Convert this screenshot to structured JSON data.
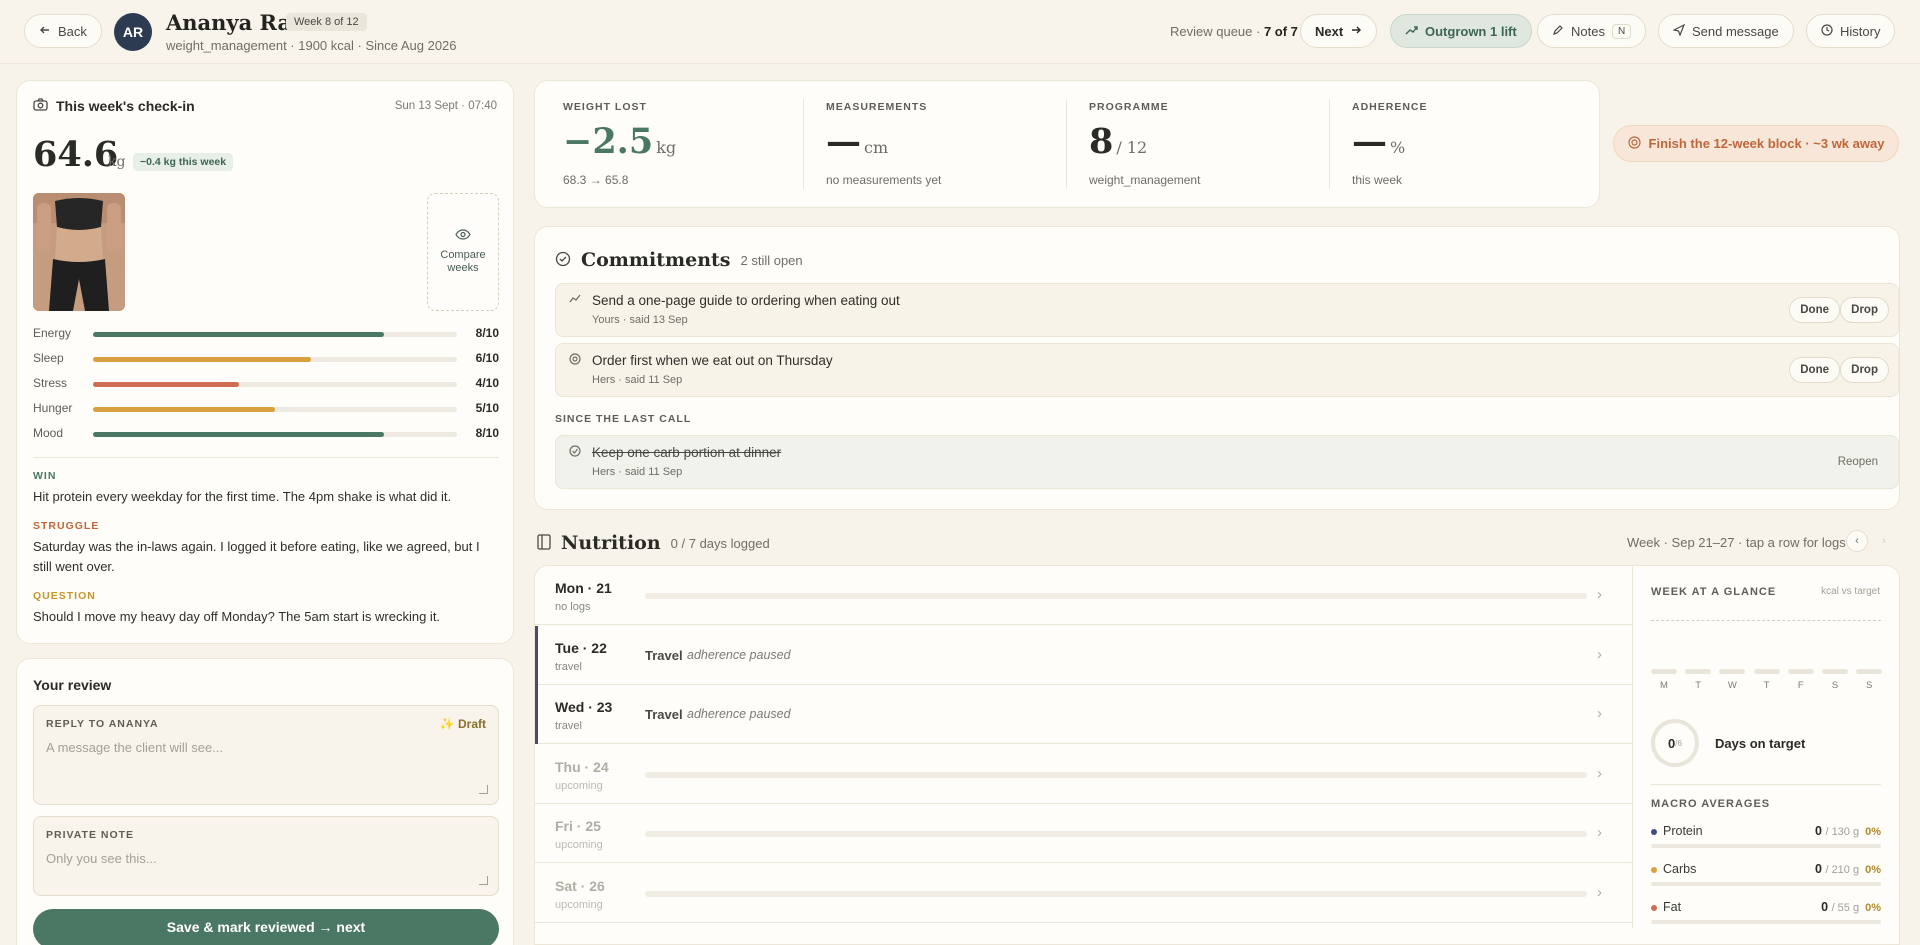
{
  "header": {
    "back_label": "Back",
    "avatar_initials": "AR",
    "client_name": "Ananya Rao",
    "week_badge": "Week 8 of 12",
    "client_sub": "weight_management · 1900 kcal · Since Aug 2026",
    "queue_label": "Review queue ·",
    "queue_pos": "7 of 7",
    "next_label": "Next",
    "outgrown_label": "Outgrown 1 lift",
    "notes_label": "Notes",
    "notes_shortcut": "N",
    "send_label": "Send message",
    "history_label": "History"
  },
  "checkin": {
    "title": "This week's check-in",
    "timestamp": "Sun 13 Sept · 07:40",
    "weight": "64.6",
    "unit": "kg",
    "delta": "−0.4 kg this week",
    "compare_label": "Compare weeks",
    "metrics": [
      {
        "label": "Energy",
        "value": "8/10",
        "score": 8,
        "color": "#4b7765"
      },
      {
        "label": "Sleep",
        "value": "6/10",
        "score": 6,
        "color": "#d8a03e"
      },
      {
        "label": "Stress",
        "value": "4/10",
        "score": 4,
        "color": "#cf6d52"
      },
      {
        "label": "Hunger",
        "value": "5/10",
        "score": 5,
        "color": "#d8a03e"
      },
      {
        "label": "Mood",
        "value": "8/10",
        "score": 8,
        "color": "#4b7765"
      }
    ],
    "win_label": "WIN",
    "win_text": "Hit protein every weekday for the first time. The 4pm shake is what did it.",
    "struggle_label": "STRUGGLE",
    "struggle_text": "Saturday was the in-laws again. I logged it before eating, like we agreed, but I still went over.",
    "question_label": "QUESTION",
    "question_text": "Should I move my heavy day off Monday? The 5am start is wrecking it."
  },
  "review": {
    "title": "Your review",
    "reply_label": "REPLY TO ANANYA",
    "draft_label": "Draft",
    "reply_placeholder": "A message the client will see...",
    "note_label": "PRIVATE NOTE",
    "note_placeholder": "Only you see this...",
    "save_label": "Save & mark reviewed → next"
  },
  "stats": [
    {
      "label": "WEIGHT LOST",
      "value": "−2.5",
      "unit": "kg",
      "sub": "68.3 → 65.8"
    },
    {
      "label": "MEASUREMENTS",
      "value": "—",
      "unit": "cm",
      "sub": "no measurements yet"
    },
    {
      "label": "PROGRAMME",
      "value": "8",
      "unit": "/ 12",
      "sub": "weight_management"
    },
    {
      "label": "ADHERENCE",
      "value": "—",
      "unit": "%",
      "sub": "this week"
    }
  ],
  "goal_pill": "Finish the 12-week block · ~3 wk away",
  "commitments": {
    "title": "Commitments",
    "count": "2 still open",
    "open": [
      {
        "text": "Send a one-page guide to ordering when eating out",
        "sub": "Yours · said 13 Sep"
      },
      {
        "text": "Order first when we eat out on Thursday",
        "sub": "Hers · said 11 Sep"
      }
    ],
    "done_label": "Done",
    "drop_label": "Drop",
    "since_label": "SINCE THE LAST CALL",
    "closed": {
      "text": "Keep one carb portion at dinner",
      "sub": "Hers · said 11 Sep"
    },
    "reopen_label": "Reopen"
  },
  "nutrition": {
    "title": "Nutrition",
    "logged": "0 / 7 days logged",
    "week_label": "Week · Sep 21–27 · tap a row for logs",
    "days": [
      {
        "name": "Mon · 21",
        "sub": "no logs",
        "state": "empty"
      },
      {
        "name": "Tue · 22",
        "sub": "travel",
        "state": "travel"
      },
      {
        "name": "Wed · 23",
        "sub": "travel",
        "state": "travel"
      },
      {
        "name": "Thu · 24",
        "sub": "upcoming",
        "state": "upcoming"
      },
      {
        "name": "Fri · 25",
        "sub": "upcoming",
        "state": "upcoming"
      },
      {
        "name": "Sat · 26",
        "sub": "upcoming",
        "state": "upcoming"
      }
    ],
    "travel_label": "Travel",
    "paused_label": "adherence paused",
    "glance_title": "WEEK AT A GLANCE",
    "glance_key": "kcal vs target",
    "weekday_letters": [
      "M",
      "T",
      "W",
      "T",
      "F",
      "S",
      "S"
    ],
    "days_on_target_value": "0",
    "days_on_target_total": "/6",
    "days_on_target_label": "Days on target",
    "macro_title": "MACRO AVERAGES",
    "macros": [
      {
        "name": "Protein",
        "value": "0",
        "target": "/ 130 g",
        "pct": "0%",
        "color": "#3f4d7a"
      },
      {
        "name": "Carbs",
        "value": "0",
        "target": "/ 210 g",
        "pct": "0%",
        "color": "#d8a03e"
      },
      {
        "name": "Fat",
        "value": "0",
        "target": "/ 55 g",
        "pct": "0%",
        "color": "#cf6d52"
      }
    ]
  }
}
